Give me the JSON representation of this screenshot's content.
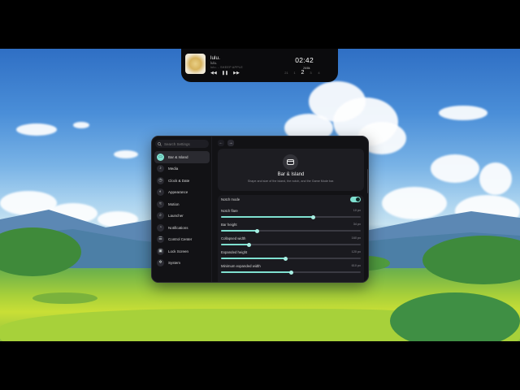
{
  "island": {
    "track_title": "lulu.",
    "track_artist": "lulu.",
    "track_album": "lulu. - SHEEP APPLE",
    "controls": [
      "◀◀",
      "❚❚",
      "▶▶"
    ],
    "clock": "02:42",
    "date_label": "26/8k",
    "days": [
      "21",
      "1",
      "2",
      "3",
      "4"
    ],
    "today_index": 2
  },
  "settings": {
    "search_placeholder": "Search Settings",
    "nav": [
      {
        "label": "Bar & Island",
        "icon": "island-icon",
        "glyph": "▭",
        "active": true
      },
      {
        "label": "Media",
        "icon": "music-note-icon",
        "glyph": "♪",
        "active": false
      },
      {
        "label": "Clock & Date",
        "icon": "clock-icon",
        "glyph": "◷",
        "active": false
      },
      {
        "label": "Appearance",
        "icon": "palette-icon",
        "glyph": "◐",
        "active": false
      },
      {
        "label": "Motion",
        "icon": "motion-icon",
        "glyph": "≈",
        "active": false
      },
      {
        "label": "Launcher",
        "icon": "rocket-icon",
        "glyph": "⌕",
        "active": false
      },
      {
        "label": "Notifications",
        "icon": "bell-icon",
        "glyph": "◔",
        "active": false
      },
      {
        "label": "Control Center",
        "icon": "sliders-icon",
        "glyph": "☰",
        "active": false
      },
      {
        "label": "Lock Screen",
        "icon": "lock-icon",
        "glyph": "▣",
        "active": false
      },
      {
        "label": "System",
        "icon": "gear-icon",
        "glyph": "✲",
        "active": false
      }
    ],
    "toolbar": {
      "back": "←",
      "forward": "→"
    },
    "hero": {
      "title": "Bar & Island",
      "subtitle": "Shape and size of the island, the notch, and the Game Mode bar."
    },
    "rows": [
      {
        "label": "Notch mode",
        "type": "toggle",
        "on": true
      },
      {
        "label": "Notch flare",
        "type": "slider",
        "value": "10 px",
        "fraction": 0.66
      },
      {
        "label": "Bar height",
        "type": "slider",
        "value": "34 px",
        "fraction": 0.26
      },
      {
        "label": "Collapsed width",
        "type": "slider",
        "value": "160 px",
        "fraction": 0.2
      },
      {
        "label": "Expanded height",
        "type": "slider",
        "value": "120 px",
        "fraction": 0.46
      },
      {
        "label": "Minimum expanded width",
        "type": "slider",
        "value": "610 px",
        "fraction": 0.5
      }
    ]
  },
  "colors": {
    "accent": "#7fe0d0",
    "panel": "#121215",
    "card": "#1d1d22"
  }
}
